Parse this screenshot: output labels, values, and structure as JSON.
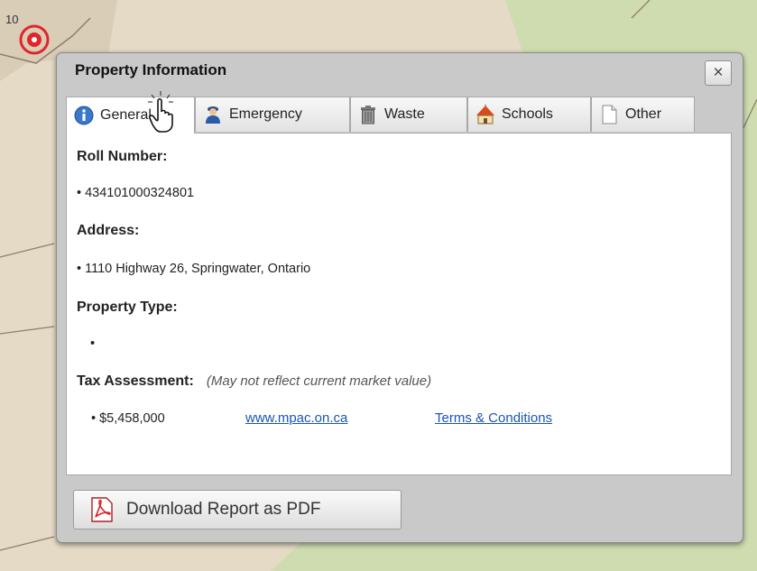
{
  "map": {
    "pin_label": "10"
  },
  "popup": {
    "title": "Property Information",
    "close_label": "×",
    "tabs": [
      {
        "label": "General",
        "icon": "info-icon",
        "active": true
      },
      {
        "label": "Emergency",
        "icon": "emergency-person-icon",
        "active": false
      },
      {
        "label": "Waste",
        "icon": "trash-can-icon",
        "active": false
      },
      {
        "label": "Schools",
        "icon": "school-house-icon",
        "active": false
      },
      {
        "label": "Other",
        "icon": "document-icon",
        "active": false
      }
    ],
    "general": {
      "roll_number_label": "Roll Number:",
      "roll_number": "• 434101000324801",
      "address_label": "Address:",
      "address": "• 1110 Highway 26, Springwater, Ontario",
      "property_type_label": "Property Type:",
      "property_type": "•",
      "tax_assessment_label": "Tax Assessment:",
      "tax_assessment_note": "(May not reflect current market value)",
      "tax_assessment_value": "• $5,458,000",
      "mpac_link": "www.mpac.on.ca",
      "terms_link": "Terms & Conditions"
    },
    "download_button_label": "Download Report as PDF"
  },
  "colors": {
    "link": "#1a55b0",
    "popup_frame": "#c9c9c9",
    "map_land": "#e3d8c3",
    "map_green": "#cddcae",
    "pin_red": "#e0262a"
  }
}
